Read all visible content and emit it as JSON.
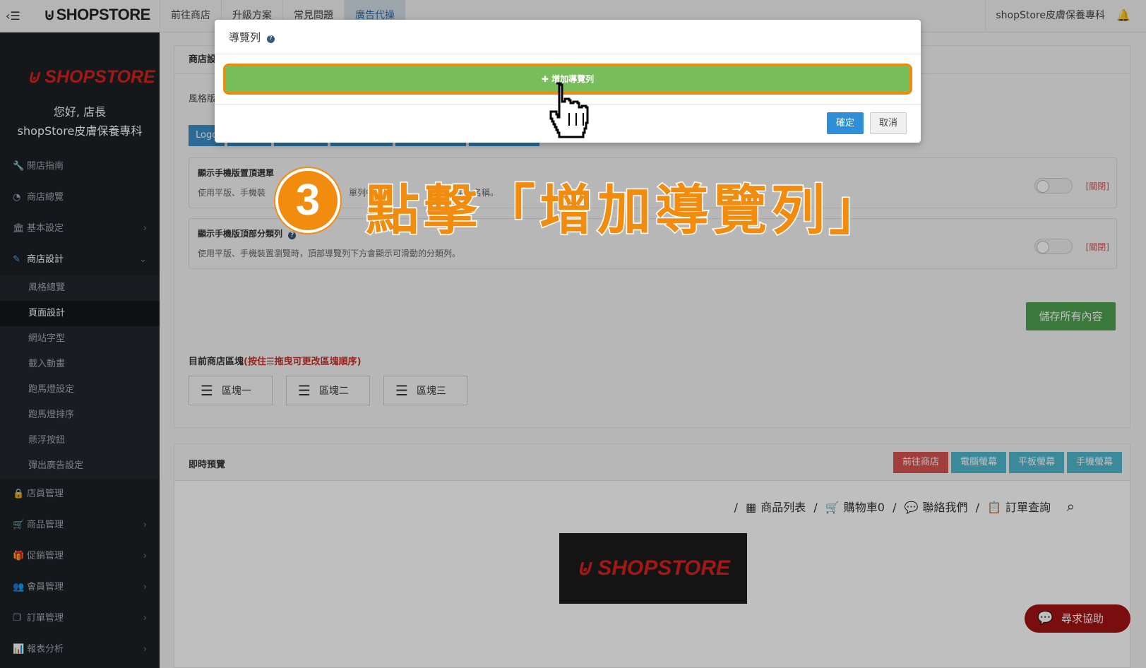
{
  "topbar": {
    "brand": "SHOPSTORE",
    "nav": [
      "前往商店",
      "升級方案",
      "常見問題",
      "廣告代操"
    ],
    "store_name": "shopStore皮膚保養專科"
  },
  "sidebar": {
    "logo": "SHOPSTORE",
    "greeting": "您好, 店長",
    "store_name": "shopStore皮膚保養專科",
    "items_top": [
      {
        "label": "開店指南",
        "icon": "wrench-icon"
      },
      {
        "label": "商店總覽",
        "icon": "dashboard-icon"
      },
      {
        "label": "基本設定",
        "icon": "bank-icon"
      },
      {
        "label": "商店設計",
        "icon": "brush-icon"
      }
    ],
    "sub_items": [
      "風格總覽",
      "頁面設計",
      "網站字型",
      "載入動畫",
      "跑馬燈設定",
      "跑馬燈排序",
      "懸浮按鈕",
      "彈出廣告設定"
    ],
    "items_bottom": [
      {
        "label": "店員管理",
        "icon": "lock-icon"
      },
      {
        "label": "商品管理",
        "icon": "cart-icon"
      },
      {
        "label": "促銷管理",
        "icon": "gift-icon"
      },
      {
        "label": "會員管理",
        "icon": "users-icon"
      },
      {
        "label": "訂單管理",
        "icon": "copy-icon"
      },
      {
        "label": "報表分析",
        "icon": "chart-icon"
      }
    ]
  },
  "panel1": {
    "header": "商店設",
    "style_label": "風格版",
    "tab_first": "Logo",
    "option1": {
      "title": "顯示手機版置頂選單",
      "desc_left": "使用平版、手機裝",
      "desc_mid": "單列中",
      "desc_right": "的中文名稱。",
      "status": "[關閉]"
    },
    "option2": {
      "title": "顯示手機版頂部分類列",
      "desc": "使用平版、手機裝置瀏覽時，頂部導覽列下方會顯示可滑動的分類列。",
      "status": "[關閉]"
    },
    "save_label": "儲存所有內容",
    "blocks_title": "目前商店區塊",
    "blocks_hint": "(按住☰拖曳可更改區塊順序)",
    "blocks": [
      "區塊一",
      "區塊二",
      "區塊三"
    ]
  },
  "panel2": {
    "header": "即時預覽",
    "buttons": [
      {
        "label": "前往商店",
        "color": "#d9534f"
      },
      {
        "label": "電腦螢幕",
        "color": "#4fb8d0"
      },
      {
        "label": "平板螢幕",
        "color": "#4fb8d0"
      },
      {
        "label": "手機螢幕",
        "color": "#4fb8d0"
      }
    ],
    "preview_nav": [
      "商品列表",
      "購物車0",
      "聯絡我們",
      "訂單查詢"
    ],
    "preview_logo": "SHOPSTORE"
  },
  "help": {
    "label": "尋求協助"
  },
  "modal": {
    "title": "導覽列",
    "add_label": "✚ 增加導覽列",
    "ok_label": "確定",
    "cancel_label": "取消"
  },
  "annotation": {
    "step": "3",
    "text": "點擊「增加導覽列」"
  }
}
